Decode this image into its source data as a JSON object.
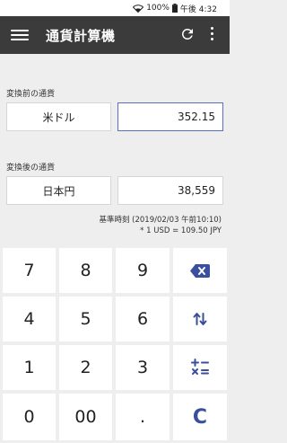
{
  "status": {
    "battery": "100%",
    "time": "午後 4:32"
  },
  "appbar": {
    "title": "通貨計算機",
    "menu_icon": "hamburger-menu-icon",
    "refresh_icon": "refresh-icon",
    "more_icon": "more-vert-icon"
  },
  "from": {
    "label": "変換前の通貨",
    "currency": "米ドル",
    "amount": "352.15"
  },
  "to": {
    "label": "変換後の通貨",
    "currency": "日本円",
    "amount": "38,559"
  },
  "rate": {
    "timestamp": "基準時刻 (2019/02/03 午前10:10)",
    "formula": "* 1 USD = 109.50 JPY"
  },
  "keypad": {
    "k7": "7",
    "k8": "8",
    "k9": "9",
    "k4": "4",
    "k5": "5",
    "k6": "6",
    "k1": "1",
    "k2": "2",
    "k3": "3",
    "k0": "0",
    "k00": "00",
    "kdot": ".",
    "kclear": "C",
    "accent": "#3a4f9e"
  }
}
